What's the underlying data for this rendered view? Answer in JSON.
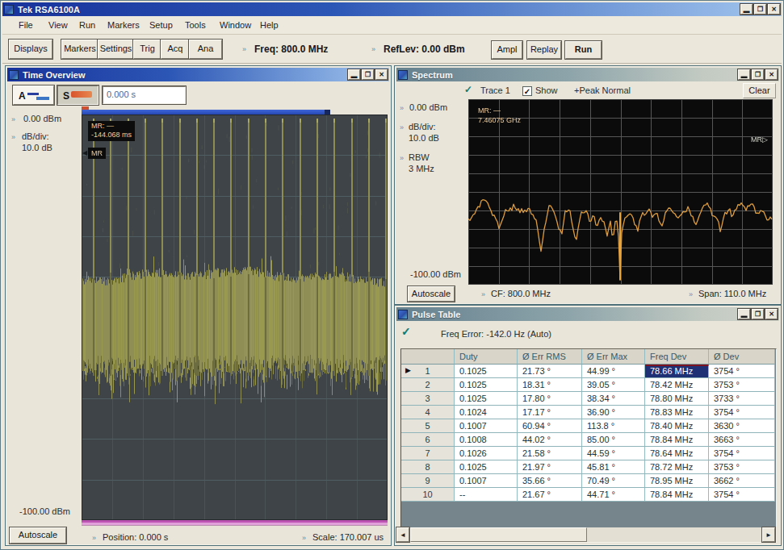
{
  "window": {
    "title": "Tek RSA6100A"
  },
  "menu": {
    "items": [
      "File",
      "View",
      "Run",
      "Markers",
      "Setup",
      "Tools",
      "Window",
      "Help"
    ]
  },
  "toolbar": {
    "displays": "Displays",
    "group": [
      "Markers",
      "Settings",
      "Trig",
      "Acq",
      "Ana"
    ],
    "freq_label": "Freq: 800.0 MHz",
    "reflev_label": "RefLev: 0.00 dBm",
    "ampl": "Ampl",
    "replay": "Replay",
    "run": "Run"
  },
  "time_overview": {
    "title": "Time Overview",
    "btn_a": "A",
    "btn_s": "S",
    "offset_value": "0.000 s",
    "top_dbm": "0.00 dBm",
    "dbdiv_label": "dB/div:",
    "dbdiv_value": "10.0 dB",
    "bottom_dbm": "-100.00 dBm",
    "marker_line1": "MR: —",
    "marker_line2": "-144.068 ms",
    "marker_badge": "MR",
    "autoscale": "Autoscale",
    "position_label": "Position: 0.000 s",
    "scale_label": "Scale: 170.007 us"
  },
  "spectrum": {
    "title": "Spectrum",
    "trace_label": "Trace 1",
    "show_label": "Show",
    "detector_label": "+Peak Normal",
    "clear": "Clear",
    "top_dbm": "0.00 dBm",
    "dbdiv_label": "dB/div:",
    "dbdiv_value": "10.0 dB",
    "rbw_label": "RBW",
    "rbw_value": "3 MHz",
    "bottom_dbm": "-100.00 dBm",
    "marker_line1": "MR: —",
    "marker_line2": "7.46075 GHz",
    "marker_right": "MR",
    "autoscale": "Autoscale",
    "cf_label": "CF: 800.0 MHz",
    "span_label": "Span: 110.0 MHz"
  },
  "pulse_table": {
    "title": "Pulse Table",
    "freq_error": "Freq Error: -142.0 Hz (Auto)",
    "columns": [
      "Duty",
      "Ø Err RMS",
      "Ø Err Max",
      "Freq Dev",
      "Ø Dev"
    ],
    "selected_cell": {
      "row": 1,
      "col_index": 4,
      "column": "Freq Dev"
    },
    "rows": [
      {
        "num": "1",
        "duty": "0.1025",
        "err_rms": "21.73 °",
        "err_max": "44.99 °",
        "freq_dev": "78.66 MHz",
        "phase_dev": "3754 °"
      },
      {
        "num": "2",
        "duty": "0.1025",
        "err_rms": "18.31 °",
        "err_max": "39.05 °",
        "freq_dev": "78.42 MHz",
        "phase_dev": "3753 °"
      },
      {
        "num": "3",
        "duty": "0.1025",
        "err_rms": "17.80 °",
        "err_max": "38.34 °",
        "freq_dev": "78.80 MHz",
        "phase_dev": "3733 °"
      },
      {
        "num": "4",
        "duty": "0.1024",
        "err_rms": "17.17 °",
        "err_max": "36.90 °",
        "freq_dev": "78.83 MHz",
        "phase_dev": "3754 °"
      },
      {
        "num": "5",
        "duty": "0.1007",
        "err_rms": "60.94 °",
        "err_max": "113.8 °",
        "freq_dev": "78.40 MHz",
        "phase_dev": "3630 °"
      },
      {
        "num": "6",
        "duty": "0.1008",
        "err_rms": "44.02 °",
        "err_max": "85.00 °",
        "freq_dev": "78.84 MHz",
        "phase_dev": "3663 °"
      },
      {
        "num": "7",
        "duty": "0.1026",
        "err_rms": "21.58 °",
        "err_max": "44.59 °",
        "freq_dev": "78.64 MHz",
        "phase_dev": "3754 °"
      },
      {
        "num": "8",
        "duty": "0.1025",
        "err_rms": "21.97 °",
        "err_max": "45.81 °",
        "freq_dev": "78.72 MHz",
        "phase_dev": "3753 °"
      },
      {
        "num": "9",
        "duty": "0.1007",
        "err_rms": "35.66 °",
        "err_max": "70.49 °",
        "freq_dev": "78.95 MHz",
        "phase_dev": "3662 °"
      },
      {
        "num": "10",
        "duty": "--",
        "err_rms": "21.67 °",
        "err_max": "44.71 °",
        "freq_dev": "78.84 MHz",
        "phase_dev": "3754 °"
      }
    ]
  },
  "colors": {
    "titlebar_active_start": "#18339c",
    "titlebar_active_end": "#a3c6ee",
    "titlebar_inactive_start": "#66818f",
    "titlebar_inactive_end": "#d2d5ca",
    "chrome": "#ece8dc",
    "selected_cell": "#203075",
    "spectrum_trace": "#dd9d3e",
    "time_band": "#8f8f55",
    "magenta": "#bd53b3"
  },
  "chart_data": [
    {
      "type": "line",
      "title": "Spectrum trace (+Peak Normal)",
      "xlabel": "Frequency, CF 800.0 MHz, Span 110.0 MHz",
      "ylabel": "Amplitude (dBm), 10.0 dB/div",
      "x_range_mhz": [
        745.0,
        855.0
      ],
      "ylim": [
        0,
        -100
      ],
      "grid": true,
      "bg": "#0b0b0b",
      "grid_color": "#565656",
      "trace_color": "#dd9d3e",
      "values": [
        -64.5,
        -65.4,
        -63.8,
        -62.3,
        -61.8,
        -59.5,
        -57.9,
        -58.2,
        -54.8,
        -54.2,
        -54.4,
        -54.8,
        -55.9,
        -58.3,
        -60.0,
        -62.7,
        -62.5,
        -64.5,
        -66.1,
        -69.8,
        -67.5,
        -65.2,
        -62.9,
        -59.5,
        -60.2,
        -60.3,
        -58.6,
        -60.0,
        -56.6,
        -58.6,
        -59.8,
        -59.0,
        -61.2,
        -59.0,
        -61.1,
        -59.7,
        -60.7,
        -58.9,
        -59.1,
        -61.9,
        -62.2,
        -64.4,
        -65.1,
        -70.4,
        -76.6,
        -82.0,
        -76.4,
        -70.0,
        -66.4,
        -61.8,
        -57.3,
        -57.5,
        -59.0,
        -60.7,
        -63.3,
        -66.3,
        -70.2,
        -70.5,
        -72.6,
        -66.4,
        -60.1,
        -60.7,
        -59.7,
        -60.1,
        -65.9,
        -70.3,
        -74.3,
        -75.6,
        -69.6,
        -65.0,
        -60.8,
        -61.3,
        -61.1,
        -60.1,
        -61.8,
        -65.8,
        -65.7,
        -62.9,
        -63.3,
        -67.8,
        -68.1,
        -65.3,
        -63.8,
        -65.8,
        -66.0,
        -69.8,
        -73.8,
        -69.5,
        -65.7,
        -73.2,
        -73.0,
        -65.9,
        -65.7,
        -74.0,
        -97.5,
        -72.0,
        -67.7,
        -64.0,
        -63.5,
        -62.5,
        -61.8,
        -62.3,
        -63.9,
        -67.6,
        -68.3,
        -71.2,
        -65.8,
        -63.4,
        -61.1,
        -62.6,
        -61.8,
        -60.4,
        -59.2,
        -60.9,
        -63.7,
        -62.3,
        -61.7,
        -61.6,
        -65.5,
        -67.0,
        -68.3,
        -65.5,
        -61.2,
        -60.1,
        -58.7,
        -58.8,
        -60.2,
        -61.3,
        -61.8,
        -63.4,
        -64.0,
        -62.9,
        -62.1,
        -60.6,
        -60.8,
        -60.6,
        -57.9,
        -60.0,
        -62.9,
        -63.2,
        -66.4,
        -67.6,
        -65.4,
        -62.8,
        -60.9,
        -58.6,
        -57.1,
        -57.0,
        -56.0,
        -58.0,
        -58.9,
        -62.8,
        -63.0,
        -63.4,
        -64.5,
        -66.2,
        -71.5,
        -68.2,
        -64.1,
        -61.0,
        -61.9,
        -59.9,
        -59.1,
        -63.3,
        -62.4,
        -59.8,
        -59.4,
        -56.8,
        -57.2,
        -55.9,
        -57.2,
        -58.0,
        -60.0,
        -57.5,
        -57.6,
        -56.6,
        -56.5,
        -58.0,
        -61.5,
        -61.4,
        -61.6,
        -60.0,
        -60.4,
        -60.8,
        -62.9,
        -65.1,
        -65.0,
        -63.5,
        -64.7
      ]
    },
    {
      "type": "area",
      "title": "Time Overview (Amplitude vs Time)",
      "xlabel": "Time, Position 0.000 s, Scale 170.007 us",
      "ylabel": "dBm (0.00 to -100.00)",
      "ylim": [
        0,
        -100
      ],
      "seed": 1337,
      "pulse_count": 18,
      "pulse_first": 14,
      "pulse_step": 21.3,
      "band_top": 0.395,
      "band_solid_bottom": 0.625,
      "bg": "#3e4448",
      "grid_v": "#4a5256",
      "grid_h": "#4e5e62",
      "band_color": "#8e8e55",
      "band_hi": "#99994f",
      "band_dark": "#6c6c41",
      "pulse_color": "#8d8d52",
      "pulse_tip": "#a8a860",
      "magenta": "#bd53b3",
      "magenta_light": "#e2a0da"
    }
  ]
}
